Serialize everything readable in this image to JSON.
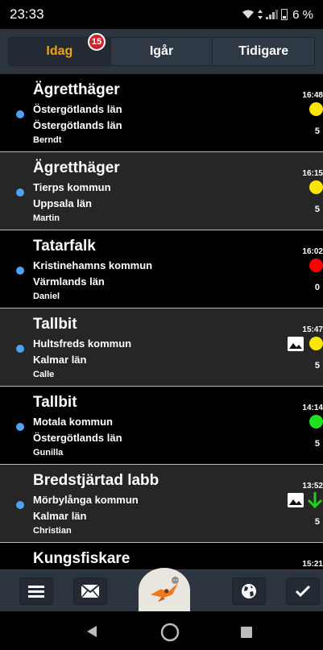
{
  "status_bar": {
    "time": "23:33",
    "battery_percent": "6 %"
  },
  "tabs": [
    {
      "label": "Idag",
      "active": true,
      "badge": "15"
    },
    {
      "label": "Igår",
      "active": false
    },
    {
      "label": "Tidigare",
      "active": false
    }
  ],
  "observations": [
    {
      "species": "Ägretthäger",
      "place": "Östergötlands län",
      "region": "Östergötlands län",
      "user": "Berndt",
      "time": "16:48",
      "status_color": "#ffe600",
      "count": "5",
      "photo": false,
      "arrow": false,
      "bg": "dark"
    },
    {
      "species": "Ägretthäger",
      "place": "Tierps kommun",
      "region": "Uppsala län",
      "user": "Martin",
      "time": "16:15",
      "status_color": "#ffe600",
      "count": "5",
      "photo": false,
      "arrow": false,
      "bg": "gray"
    },
    {
      "species": "Tatarfalk",
      "place": "Kristinehamns kommun",
      "region": "Värmlands län",
      "user": "Daniel",
      "time": "16:02",
      "status_color": "#ff0000",
      "count": "0",
      "photo": false,
      "arrow": false,
      "bg": "dark"
    },
    {
      "species": "Tallbit",
      "place": "Hultsfreds kommun",
      "region": "Kalmar län",
      "user": "Calle",
      "time": "15:47",
      "status_color": "#ffe600",
      "count": "5",
      "photo": true,
      "arrow": false,
      "bg": "gray"
    },
    {
      "species": "Tallbit",
      "place": "Motala kommun",
      "region": "Östergötlands län",
      "user": "Gunilla",
      "time": "14:14",
      "status_color": "#1fe01f",
      "count": "5",
      "photo": false,
      "arrow": false,
      "bg": "dark"
    },
    {
      "species": "Bredstjärtad labb",
      "place": "Mörbylånga kommun",
      "region": "Kalmar län",
      "user": "Christian",
      "time": "13:52",
      "status_color": "",
      "count": "5",
      "photo": true,
      "arrow": true,
      "bg": "gray"
    },
    {
      "species": "Kungsfiskare",
      "time": "15:21",
      "bg": "dark",
      "partial": true
    }
  ],
  "bottom_nav": {
    "items": [
      {
        "name": "menu-icon"
      },
      {
        "name": "mail-icon"
      },
      {
        "name": "app-logo"
      },
      {
        "name": "globe-icon"
      },
      {
        "name": "check-icon"
      }
    ]
  },
  "colors": {
    "accent": "#f4a214",
    "badge": "#d0242d",
    "dot": "#4ea1f3",
    "toolbar": "#2c3440"
  }
}
